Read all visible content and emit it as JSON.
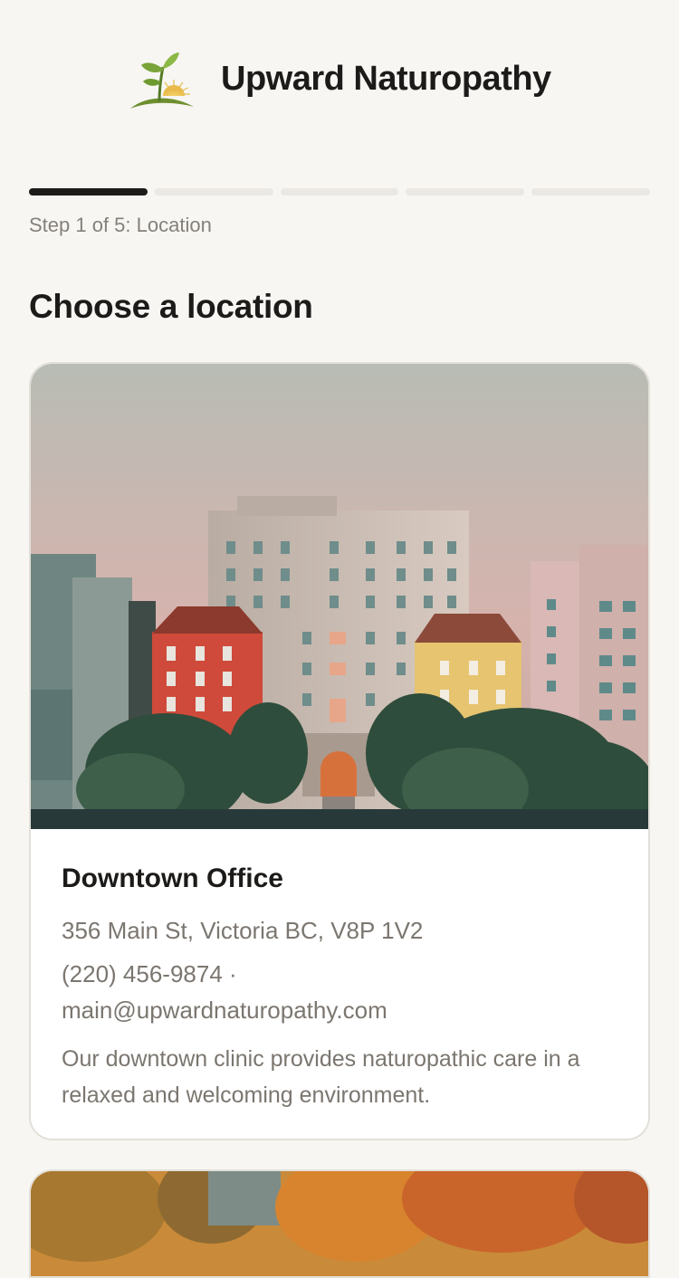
{
  "header": {
    "brand_name": "Upward Naturopathy",
    "logo_icon": "sprout-sun-logo-icon"
  },
  "progress": {
    "current_step": 1,
    "total_steps": 5,
    "label": "Step 1 of 5: Location"
  },
  "page": {
    "title": "Choose a location"
  },
  "locations": [
    {
      "name": "Downtown Office",
      "address": "356 Main St, Victoria BC, V8P 1V2",
      "phone_line": "(220) 456-9874 ·",
      "email": "main@upwardnaturopathy.com",
      "description": "Our downtown clinic provides naturopathic care in a relaxed and welcoming environment.",
      "photo": "city-building-photo"
    },
    {
      "photo": "autumn-trees-photo"
    }
  ],
  "colors": {
    "background": "#f7f6f3",
    "progress_active": "#1d1b19",
    "progress_inactive": "#ebe8e3",
    "muted_text": "#7b766f",
    "card_border": "#e3dfd9"
  }
}
